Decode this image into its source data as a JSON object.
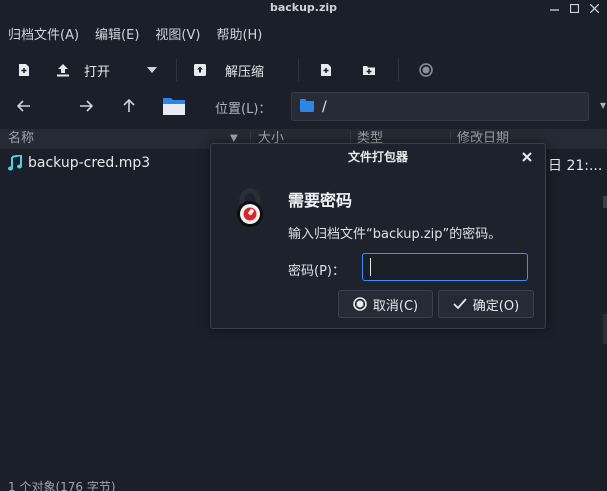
{
  "window": {
    "title": "backup.zip"
  },
  "menu": [
    {
      "label": "归档文件(A)"
    },
    {
      "label": "编辑(E)"
    },
    {
      "label": "视图(V)"
    },
    {
      "label": "帮助(H)"
    }
  ],
  "toolbar": {
    "open_label": "打开",
    "extract_label": "解压缩"
  },
  "location": {
    "label": "位置(L)：",
    "path": "/"
  },
  "columns": {
    "name": "名称",
    "size": "大小",
    "type": "类型",
    "modified": "修改日期"
  },
  "files": [
    {
      "name": "backup-cred.mp3",
      "date": "日 21:..."
    }
  ],
  "statusbar": {
    "text": "1 个对象(176 字节)"
  },
  "dialog": {
    "title": "文件打包器",
    "heading": "需要密码",
    "message": "输入归档文件“backup.zip”的密码。",
    "password_label": "密码(P)：",
    "password_value": "",
    "cancel_label": "取消(C)",
    "ok_label": "确定(O)"
  },
  "colors": {
    "accent": "#3d8ff0",
    "folder": "#2f84e8",
    "music": "#4fd1e6",
    "icon_red": "#d9262e"
  }
}
